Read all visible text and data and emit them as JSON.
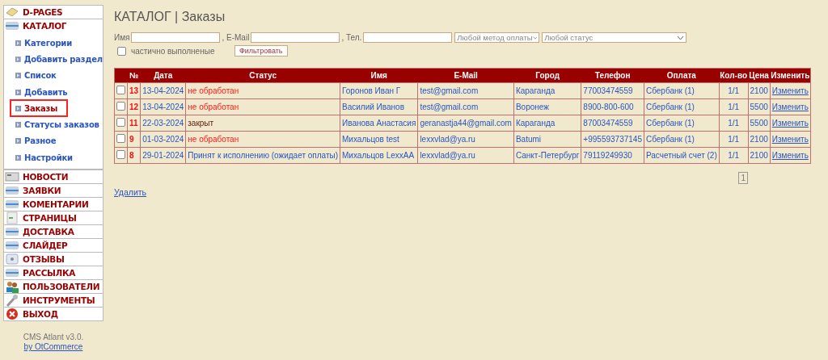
{
  "sidebar": {
    "sections": [
      {
        "label": "D-PAGES"
      },
      {
        "label": "КАТАЛОГ",
        "items": [
          {
            "label": "Категории",
            "selected": false
          },
          {
            "label": "Добавить раздел",
            "selected": false
          },
          {
            "label": "Список",
            "selected": false
          },
          {
            "label": "Добавить",
            "selected": false
          },
          {
            "label": "Заказы",
            "selected": true
          },
          {
            "label": "Статусы заказов",
            "selected": false
          },
          {
            "label": "Разное",
            "selected": false
          },
          {
            "label": "Настройки",
            "selected": false
          }
        ]
      },
      {
        "label": "НОВОСТИ"
      },
      {
        "label": "ЗАЯВКИ"
      },
      {
        "label": "КОМЕНТАРИИ"
      },
      {
        "label": "СТРАНИЦЫ"
      },
      {
        "label": "ДОСТАВКА"
      },
      {
        "label": "СЛАЙДЕР"
      },
      {
        "label": "ОТЗЫВЫ"
      },
      {
        "label": "РАССЫЛКА"
      },
      {
        "label": "ПОЛЬЗОВАТЕЛИ"
      },
      {
        "label": "ИНСТРУМЕНТЫ"
      },
      {
        "label": "ВЫХОД"
      }
    ],
    "version": "CMS Atlant v3.0.",
    "credit_link": "by OtCommerce"
  },
  "page_title": "КАТАЛОГ | Заказы",
  "filters": {
    "name_label": "Имя",
    "email_label": ", E-Mail",
    "phone_label": ", Тел.",
    "payment_select": "Любой метод оплаты",
    "status_select": "Любой статус",
    "partial_checkbox": {
      "label": "частично выполненые",
      "checked": false
    },
    "filter_button": "Фильтровать"
  },
  "table": {
    "columns": [
      "№",
      "Дата",
      "Статус",
      "Имя",
      "E-Mail",
      "Город",
      "Телефон",
      "Оплата",
      "Кол-во",
      "Цена",
      "Изменить"
    ],
    "rows": [
      {
        "checked": false,
        "number": "13",
        "date": "13-04-2024",
        "status": "не обработан",
        "kind": "new",
        "name": "Горонов Иван Г",
        "email": "test@gmail.com",
        "city": "Караганда",
        "phone": "77003474559",
        "payment": "Сбербанк (1)",
        "quantity": "1/1",
        "price": "2100",
        "edit": "Изменить"
      },
      {
        "checked": false,
        "number": "12",
        "date": "13-04-2024",
        "status": "не обработан",
        "kind": "new",
        "name": "Василий Иванов",
        "email": "test@gmail.com",
        "city": "Воронеж",
        "phone": "8900-800-600",
        "payment": "Сбербанк (1)",
        "quantity": "1/1",
        "price": "5500",
        "edit": "Изменить"
      },
      {
        "checked": false,
        "number": "11",
        "date": "22-03-2024",
        "status": "закрыт",
        "kind": "closed",
        "name": "Иванова Анастасия",
        "email": "geranastja44@gmail.com",
        "city": "Караганда",
        "phone": "87003474559",
        "payment": "Сбербанк (1)",
        "quantity": "1/1",
        "price": "5500",
        "edit": "Изменить"
      },
      {
        "checked": false,
        "number": "9",
        "date": "01-03-2024",
        "status": "не обработан",
        "kind": "new",
        "name": "Михальцов test",
        "email": "lexxvlad@ya.ru",
        "city": "Batumi",
        "phone": "+995593737145",
        "payment": "Сбербанк (1)",
        "quantity": "1/1",
        "price": "2100",
        "edit": "Изменить"
      },
      {
        "checked": false,
        "number": "8",
        "date": "29-01-2024",
        "status": "Принят к исполнению (ожидает оплаты)",
        "kind": "accepted",
        "name": "Михальцов LexxAA",
        "email": "lexxvlad@ya.ru",
        "city": "Санкт-Петербург",
        "phone": "79119249930",
        "payment": "Расчетный счет (2)",
        "quantity": "1/1",
        "price": "2100",
        "edit": "Изменить"
      }
    ]
  },
  "pagination": [
    "1"
  ],
  "delete_link": "Удалить"
}
